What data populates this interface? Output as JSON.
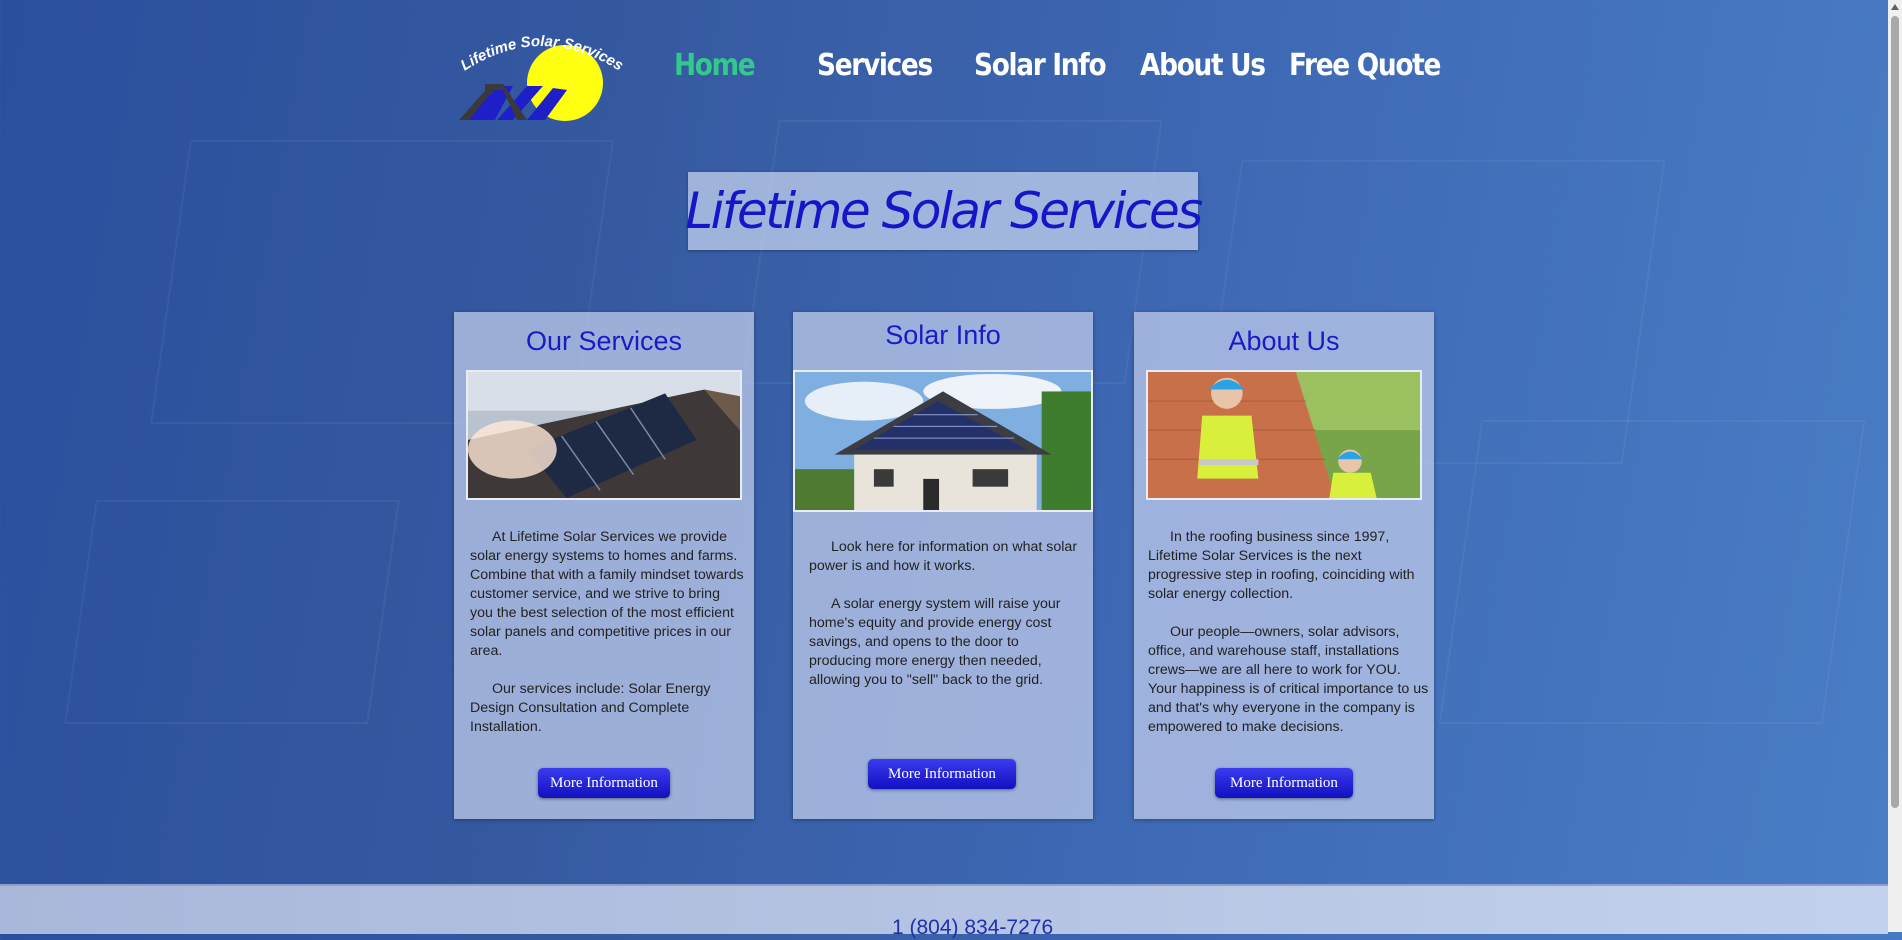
{
  "logo": {
    "text": "Lifetime Solar Services"
  },
  "nav": {
    "items": [
      {
        "label": "Home",
        "active": true
      },
      {
        "label": "Services"
      },
      {
        "label": "Solar Info"
      },
      {
        "label": "About Us"
      },
      {
        "label": "Free Quote"
      }
    ]
  },
  "hero": {
    "title": "Lifetime Solar Services"
  },
  "cards": [
    {
      "title": "Our Services",
      "image_icon": "solar-roof-photo",
      "paragraphs": [
        "At Lifetime Solar Services we provide solar energy systems to homes and farms. Combine that with a family mindset towards customer service, and we strive to bring you the best selection of  the most efficient solar panels and competitive prices in our area.",
        "Our services include: Solar Energy Design Consultation and Complete Installation."
      ],
      "button": "More Information"
    },
    {
      "title": "Solar Info",
      "image_icon": "solar-house-photo",
      "paragraphs": [
        "Look here for information on what solar power is and how it works.",
        "A solar energy system will raise your home's equity and provide energy cost savings, and opens to the door to producing more energy then needed, allowing you to \"sell\" back to the grid."
      ],
      "button": "More Information"
    },
    {
      "title": "About Us",
      "image_icon": "roofing-workers-photo",
      "paragraphs": [
        "In the roofing business since 1997, Lifetime Solar Services is the next progressive step in roofing, coinciding with solar energy collection.",
        "Our people—owners, solar advisors, office, and warehouse staff, installations crews—we are all here to work for YOU. Your happiness is of critical importance to us and that's why everyone in the company is empowered to make decisions."
      ],
      "button": "More Information"
    }
  ],
  "footer": {
    "phone": "1 (804) 834-7276"
  },
  "colors": {
    "accent": "#33c98b",
    "title_blue": "#1a1ac6",
    "button_blue": "#1f1fd8"
  }
}
